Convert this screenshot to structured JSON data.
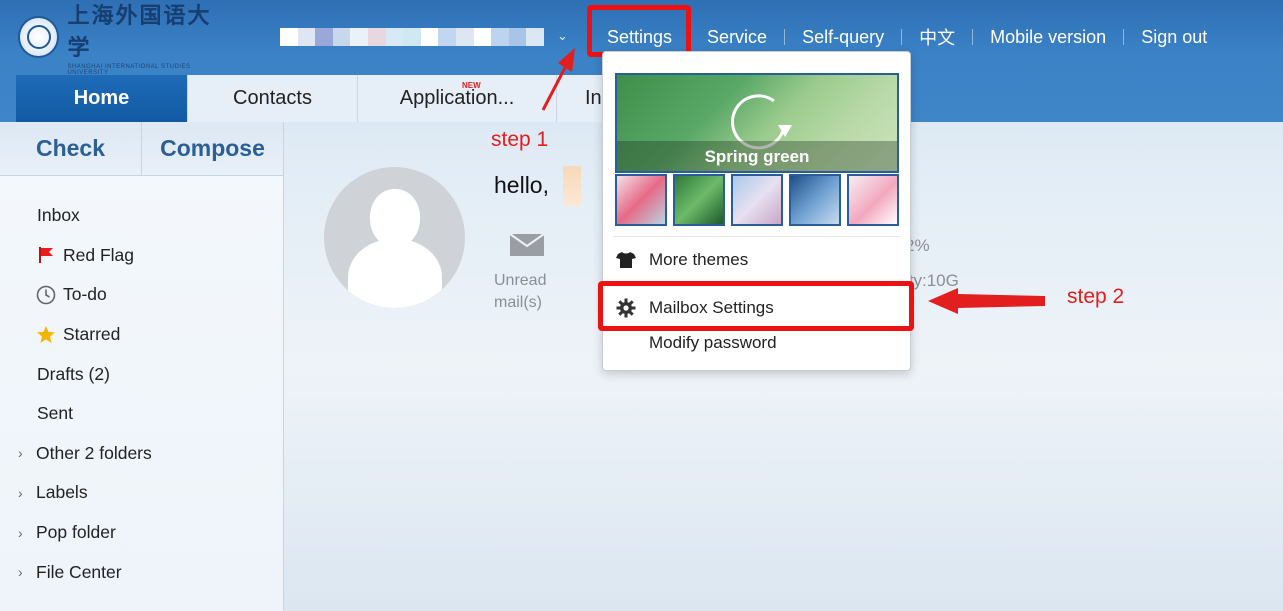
{
  "logo": {
    "cn": "上海外国语大学",
    "en": "SHANGHAI INTERNATIONAL STUDIES UNIVERSITY"
  },
  "user": {
    "chevron": "⌄"
  },
  "topnav": {
    "settings": "Settings",
    "service": "Service",
    "self_query": "Self-query",
    "chinese": "中文",
    "mobile": "Mobile version",
    "signout": "Sign out"
  },
  "tabs": [
    {
      "label": "Home",
      "active": true
    },
    {
      "label": "Contacts"
    },
    {
      "label": "Application...",
      "badge": "NEW"
    },
    {
      "label": "In"
    }
  ],
  "sidebar": {
    "check": "Check",
    "compose": "Compose",
    "folders": [
      {
        "label": "Inbox",
        "icon": ""
      },
      {
        "label": "Red Flag",
        "icon": "flag-icon"
      },
      {
        "label": "To-do",
        "icon": "clock-icon"
      },
      {
        "label": "Starred",
        "icon": "star-icon"
      },
      {
        "label": "Drafts (2)",
        "icon": ""
      },
      {
        "label": "Sent",
        "icon": ""
      },
      {
        "label": "Other 2 folders",
        "expandable": true
      },
      {
        "label": "Labels",
        "expandable": true
      },
      {
        "label": "Pop folder",
        "expandable": true
      },
      {
        "label": "File Center",
        "expandable": true
      }
    ]
  },
  "main": {
    "hello": "hello,",
    "unread_line1": "Unread",
    "unread_line2": "mail(s)",
    "partial_percent": "2%",
    "partial_capacity": "ity:10G"
  },
  "dropdown": {
    "theme_name": "Spring green",
    "more_themes": "More themes",
    "mailbox_settings": "Mailbox Settings",
    "modify_password": "Modify password"
  },
  "annotations": {
    "step1": "step 1",
    "step2": "step 2"
  },
  "colors": {
    "highlight": "#ee1111",
    "accent": "#1e6bb8",
    "topbar": "#3b82c6"
  }
}
